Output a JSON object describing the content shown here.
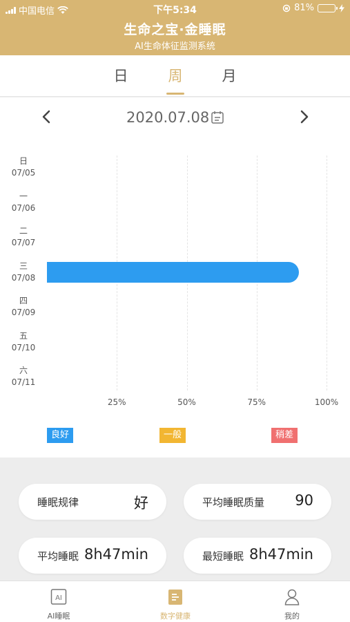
{
  "status_bar": {
    "carrier": "中国电信",
    "time": "下午5:34",
    "battery_text": "81%",
    "battery_level": 0.81
  },
  "header": {
    "title": "生命之宝·金睡眠",
    "subtitle": "AI生命体征监测系统"
  },
  "tabs": [
    {
      "label": "日",
      "active": false
    },
    {
      "label": "周",
      "active": true
    },
    {
      "label": "月",
      "active": false
    }
  ],
  "date_nav": {
    "date": "2020.07.08",
    "prev_icon": "chevron-left-icon",
    "next_icon": "chevron-right-icon",
    "calendar_icon": "calendar-icon"
  },
  "chart_data": {
    "type": "bar",
    "orientation": "horizontal",
    "categories": [
      {
        "weekday": "日",
        "date": "07/05"
      },
      {
        "weekday": "一",
        "date": "07/06"
      },
      {
        "weekday": "二",
        "date": "07/07"
      },
      {
        "weekday": "三",
        "date": "07/08"
      },
      {
        "weekday": "四",
        "date": "07/09"
      },
      {
        "weekday": "五",
        "date": "07/10"
      },
      {
        "weekday": "六",
        "date": "07/11"
      }
    ],
    "values": [
      null,
      null,
      null,
      90,
      null,
      null,
      null
    ],
    "xlim": [
      0,
      100
    ],
    "x_ticks": [
      "25%",
      "50%",
      "75%",
      "100%"
    ],
    "grid": true,
    "bar_color": "#2d9cf0"
  },
  "legend": [
    {
      "label": "良好",
      "color": "#2d9cf0"
    },
    {
      "label": "一般",
      "color": "#f2b632"
    },
    {
      "label": "稍差",
      "color": "#f07070"
    }
  ],
  "stats": {
    "regularity": {
      "label": "睡眠规律",
      "value": "好"
    },
    "avg_quality": {
      "label": "平均睡眠质量",
      "value": "90"
    },
    "avg_sleep": {
      "label": "平均睡眠",
      "value": "8h47min"
    },
    "min_sleep": {
      "label": "最短睡眠",
      "value": "8h47min"
    }
  },
  "bottom_nav": [
    {
      "label": "AI睡眠",
      "icon": "ai-icon",
      "active": false
    },
    {
      "label": "数字健康",
      "icon": "document-icon",
      "active": true
    },
    {
      "label": "我的",
      "icon": "user-icon",
      "active": false
    }
  ],
  "colors": {
    "brand": "#d8b673",
    "accent_blue": "#2d9cf0"
  }
}
